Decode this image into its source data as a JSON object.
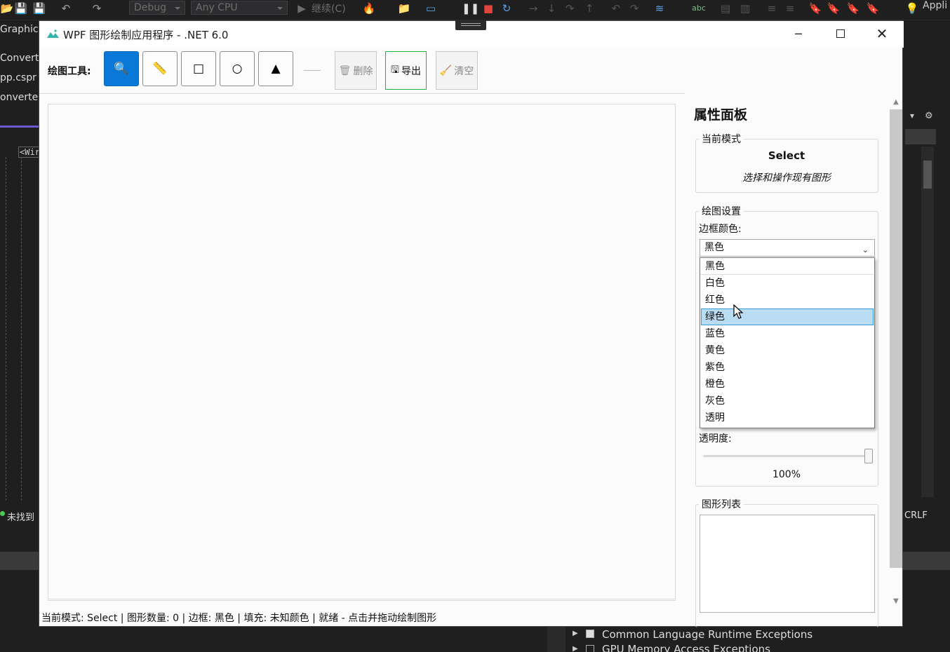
{
  "ide": {
    "build_config": "Debug",
    "platform": "Any CPU",
    "continue_label": "继续(C)",
    "right_cut_text": "Appli",
    "left_tabs": [
      "Graphic",
      "Convert",
      "pp.cspr",
      "onverte"
    ],
    "editor_tag": "<Wir",
    "left_status": "未找到",
    "line_ending": "CRLF",
    "exception_items": [
      "Common Language Runtime Exceptions",
      "GPU Memory Access Exceptions"
    ]
  },
  "window": {
    "title": "WPF 图形绘制应用程序 - .NET 6.0"
  },
  "toolbar": {
    "label": "绘图工具:",
    "tools": [
      {
        "name": "select",
        "icon": "magnifier-icon",
        "glyph": "🔍",
        "active": true
      },
      {
        "name": "line",
        "icon": "line-icon",
        "glyph": "📏",
        "active": false
      },
      {
        "name": "rectangle",
        "icon": "square-icon",
        "glyph": "□",
        "active": false
      },
      {
        "name": "ellipse",
        "icon": "circle-icon",
        "glyph": "○",
        "active": false
      },
      {
        "name": "triangle",
        "icon": "triangle-icon",
        "glyph": "▲",
        "active": false
      }
    ],
    "delete_label": "删除",
    "export_label": "导出",
    "clear_label": "清空"
  },
  "status": {
    "text": "当前模式: Select | 图形数量: 0 | 边框: 黑色 | 填充: 未知颜色 | 就绪 - 点击并拖动绘制图形"
  },
  "panel": {
    "title": "属性面板",
    "mode_group": "当前模式",
    "mode_name": "Select",
    "mode_desc": "选择和操作现有图形",
    "draw_group": "绘图设置",
    "border_color_label": "边框颜色:",
    "border_color_value": "黑色",
    "color_options": [
      "黑色",
      "白色",
      "红色",
      "绿色",
      "蓝色",
      "黄色",
      "紫色",
      "橙色",
      "灰色",
      "透明"
    ],
    "hovered_option": "绿色",
    "opacity_label": "透明度:",
    "opacity_value": "100%",
    "opacity_fraction": 1.0,
    "shapes_group": "图形列表"
  },
  "colors": {
    "accent": "#0a78d7",
    "export_border": "#19b73a",
    "highlight": "#b9dcf3"
  }
}
